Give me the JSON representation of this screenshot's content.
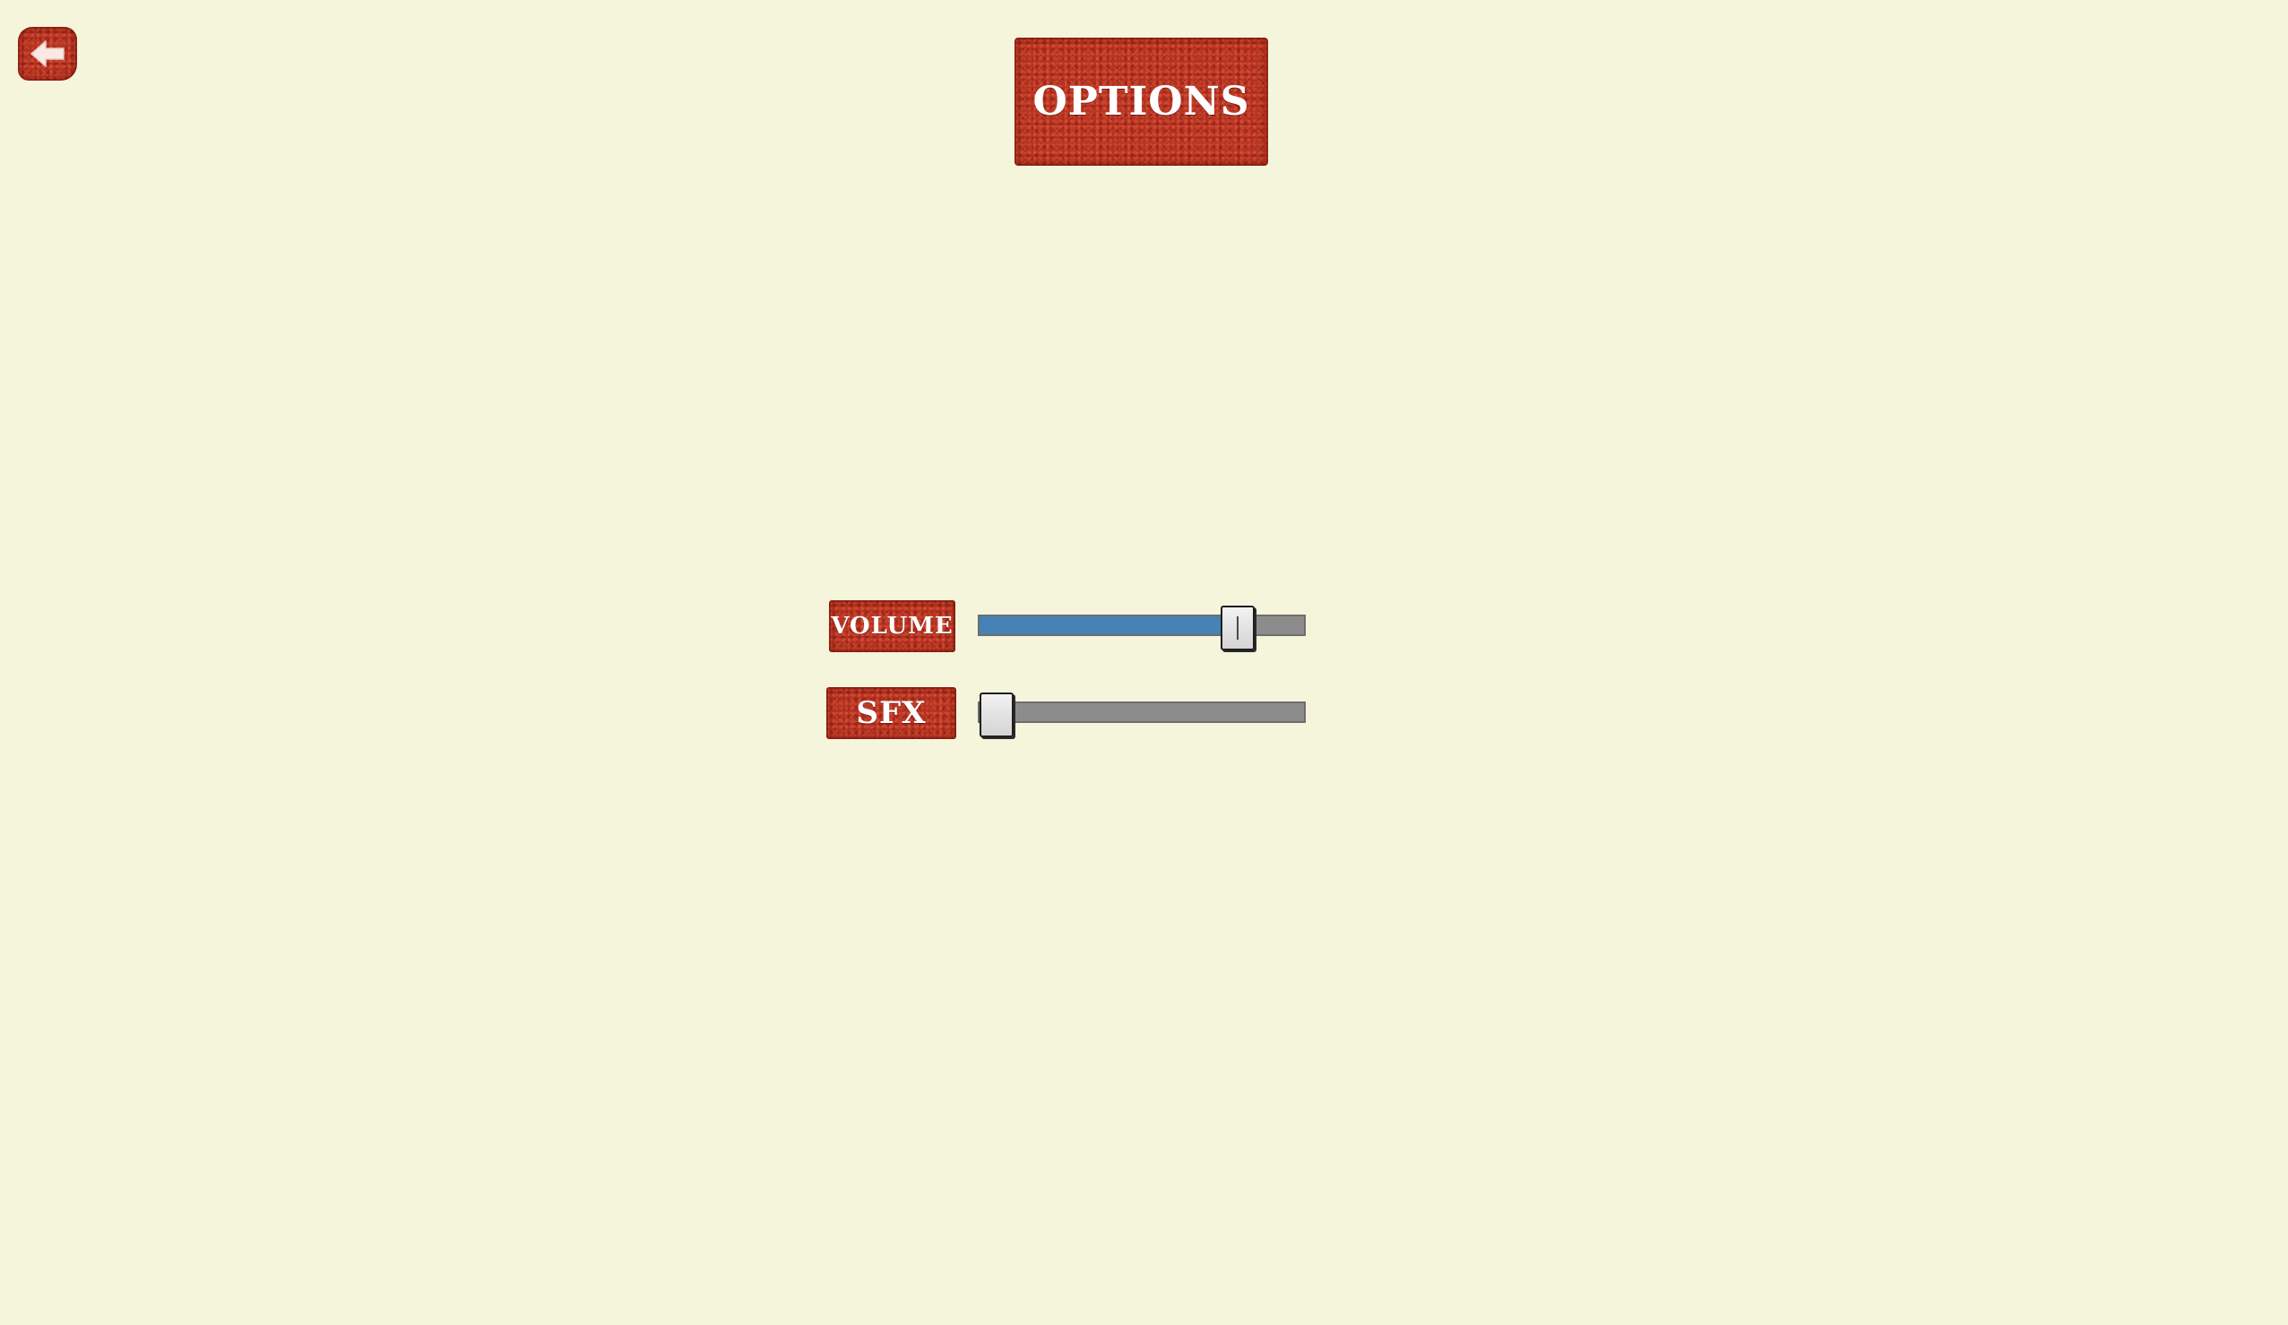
{
  "screen": {
    "title": "OPTIONS"
  },
  "back_button": {
    "icon": "left-arrow-icon"
  },
  "settings": {
    "volume": {
      "label": "VOLUME",
      "value": 0.83
    },
    "sfx": {
      "label": "SFX",
      "value": 0.0
    }
  },
  "colors": {
    "background": "#f5f5dc",
    "plate_red": "#b83220",
    "slider_fill": "#4682b4",
    "slider_track": "#8c8c8c"
  }
}
